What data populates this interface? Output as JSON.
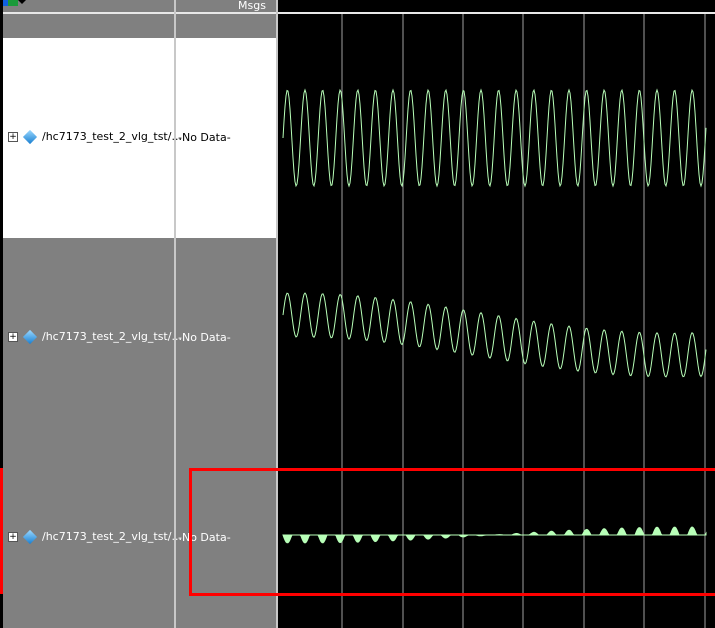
{
  "header": {
    "msgs_label": "Msgs"
  },
  "signals": [
    {
      "name": "/hc7173_test_2_vlg_tst/...",
      "value": "-No Data-"
    },
    {
      "name": "/hc7173_test_2_vlg_tst/...",
      "value": "-No Data-"
    },
    {
      "name": "/hc7173_test_2_vlg_tst/...",
      "value": "-No Data-"
    }
  ],
  "colors": {
    "wave": "#b8ffb8",
    "highlight": "#ff0000",
    "grid": "#a0a0a0"
  }
}
